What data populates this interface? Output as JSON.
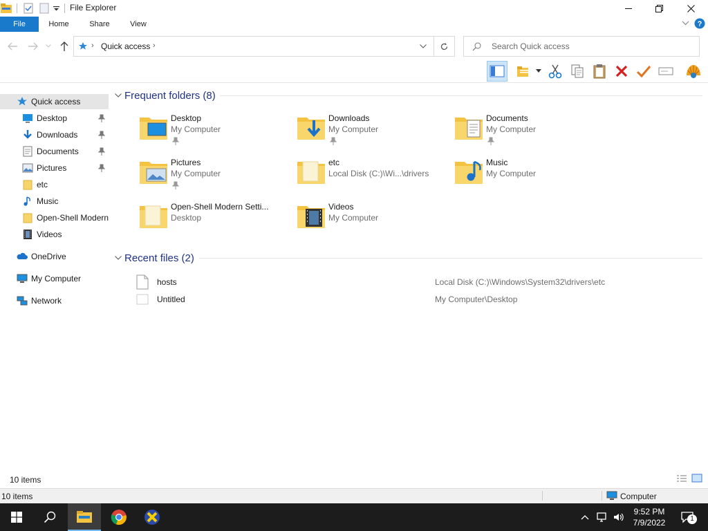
{
  "window": {
    "title": "File Explorer"
  },
  "ribbon": {
    "tabs": [
      "File",
      "Home",
      "Share",
      "View"
    ]
  },
  "address": {
    "location": "Quick access",
    "search_placeholder": "Search Quick access"
  },
  "nav": {
    "quick_access": "Quick access",
    "items": [
      "Desktop",
      "Downloads",
      "Documents",
      "Pictures",
      "etc",
      "Music",
      "Open-Shell Modern",
      "Videos"
    ],
    "onedrive": "OneDrive",
    "my_computer": "My Computer",
    "network": "Network"
  },
  "frequent": {
    "header": "Frequent folders (8)",
    "folders": [
      {
        "name": "Desktop",
        "location": "My Computer",
        "pinned": true,
        "icon": "desktop-folder-icon"
      },
      {
        "name": "Downloads",
        "location": "My Computer",
        "pinned": true,
        "icon": "downloads-folder-icon"
      },
      {
        "name": "Documents",
        "location": "My Computer",
        "pinned": true,
        "icon": "documents-folder-icon"
      },
      {
        "name": "Pictures",
        "location": "My Computer",
        "pinned": true,
        "icon": "pictures-folder-icon"
      },
      {
        "name": "etc",
        "location": "Local Disk (C:)\\Wi...\\drivers",
        "pinned": false,
        "icon": "folder-icon"
      },
      {
        "name": "Music",
        "location": "My Computer",
        "pinned": false,
        "icon": "music-folder-icon"
      },
      {
        "name": "Open-Shell Modern Setti...",
        "location": "Desktop",
        "pinned": false,
        "icon": "folder-icon"
      },
      {
        "name": "Videos",
        "location": "My Computer",
        "pinned": false,
        "icon": "videos-folder-icon"
      }
    ]
  },
  "recent": {
    "header": "Recent files (2)",
    "files": [
      {
        "name": "hosts",
        "path": "Local Disk (C:)\\Windows\\System32\\drivers\\etc"
      },
      {
        "name": "Untitled",
        "path": "My Computer\\Desktop"
      }
    ]
  },
  "status": {
    "items": "10 items",
    "items2": "10 items",
    "zone": "Computer"
  },
  "taskbar": {
    "time": "9:52 PM",
    "date": "7/9/2022",
    "notifications": "1"
  },
  "colors": {
    "accent": "#1979ca",
    "folder": "#f5c342",
    "taskbar": "#1c1c1c"
  }
}
